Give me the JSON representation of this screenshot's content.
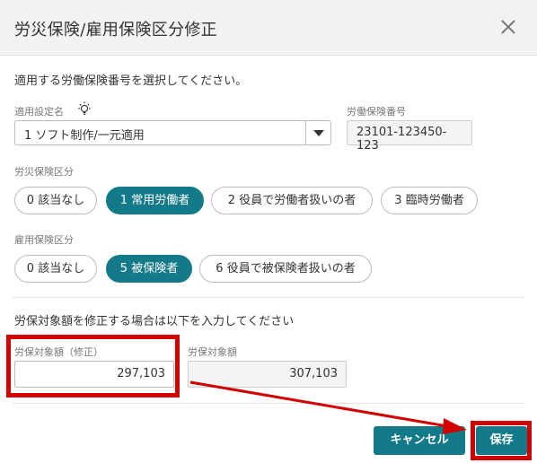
{
  "dialog": {
    "title": "労災保険/雇用保険区分修正",
    "instruction": "適用する労働保険番号を選択してください。"
  },
  "setting": {
    "label": "適用設定名",
    "selected": "1 ソフト制作/一元適用"
  },
  "insurance_number": {
    "label": "労働保険番号",
    "value": "23101-123450-123"
  },
  "rosai": {
    "label": "労災保険区分",
    "options": [
      "0 該当なし",
      "1 常用労働者",
      "2 役員で労働者扱いの者",
      "3 臨時労働者"
    ],
    "selected_index": 1
  },
  "koyo": {
    "label": "雇用保険区分",
    "options": [
      "0 該当なし",
      "5 被保険者",
      "6 役員で被保険者扱いの者"
    ],
    "selected_index": 1
  },
  "amount": {
    "instruction": "労保対象額を修正する場合は以下を入力してください",
    "corrected_label": "労保対象額（修正）",
    "corrected_value": "297,103",
    "original_label": "労保対象額",
    "original_value": "307,103"
  },
  "footer": {
    "cancel_label": "キャンセル",
    "save_label": "保存"
  },
  "colors": {
    "accent": "#137a89",
    "annotation": "#d30000"
  },
  "icons": {
    "close": "close-icon",
    "bulb": "lightbulb-icon",
    "dropdown": "chevron-down-icon"
  }
}
